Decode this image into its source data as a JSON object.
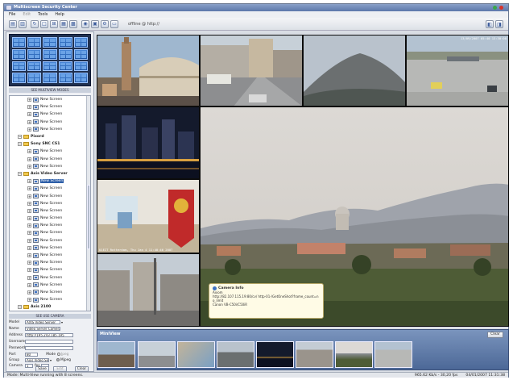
{
  "window": {
    "title": "Multiscreen Security Center",
    "colors": {
      "close": "#d8322a",
      "min": "#3aa84a"
    }
  },
  "menu": [
    "File",
    "Edit",
    "Tools",
    "Help"
  ],
  "menu_disabled": [
    "Edit"
  ],
  "toolbar": {
    "icons": [
      "open-icon",
      "save-icon",
      "refresh-icon",
      "layout-1-icon",
      "layout-4-icon",
      "layout-9-icon",
      "layout-16-icon",
      "snapshot-icon",
      "print-icon",
      "settings-icon",
      "monitor-icon"
    ],
    "address": "offline @ http://",
    "right_icons": [
      "monitor-left-icon",
      "monitor-right-icon"
    ]
  },
  "left": {
    "presets_label": "SEE MULTIVIEW MODES",
    "tree": [
      {
        "level": 1,
        "kind": "screen",
        "label": "New Screen"
      },
      {
        "level": 1,
        "kind": "screen",
        "label": "New Screen"
      },
      {
        "level": 1,
        "kind": "screen",
        "label": "New Screen"
      },
      {
        "level": 1,
        "kind": "screen",
        "label": "New Screen"
      },
      {
        "level": 1,
        "kind": "screen",
        "label": "New Screen"
      },
      {
        "level": 0,
        "kind": "folder",
        "label": "Pixord"
      },
      {
        "level": 0,
        "kind": "folder",
        "label": "Sony SNC CS1"
      },
      {
        "level": 1,
        "kind": "screen",
        "label": "New Screen"
      },
      {
        "level": 1,
        "kind": "screen",
        "label": "New Screen"
      },
      {
        "level": 1,
        "kind": "screen",
        "label": "New Screen"
      },
      {
        "level": 0,
        "kind": "folder",
        "label": "Axis Video Server"
      },
      {
        "level": 1,
        "kind": "screen",
        "label": "New Screen",
        "selected": true
      },
      {
        "level": 1,
        "kind": "screen",
        "label": "New Screen"
      },
      {
        "level": 1,
        "kind": "screen",
        "label": "New Screen"
      },
      {
        "level": 1,
        "kind": "screen",
        "label": "New Screen"
      },
      {
        "level": 1,
        "kind": "screen",
        "label": "New Screen"
      },
      {
        "level": 1,
        "kind": "screen",
        "label": "New Screen"
      },
      {
        "level": 1,
        "kind": "screen",
        "label": "New Screen"
      },
      {
        "level": 1,
        "kind": "screen",
        "label": "New Screen"
      },
      {
        "level": 1,
        "kind": "screen",
        "label": "New Screen"
      },
      {
        "level": 1,
        "kind": "screen",
        "label": "New Screen"
      },
      {
        "level": 1,
        "kind": "screen",
        "label": "New Screen"
      },
      {
        "level": 1,
        "kind": "screen",
        "label": "New Screen"
      },
      {
        "level": 1,
        "kind": "screen",
        "label": "New Screen"
      },
      {
        "level": 1,
        "kind": "screen",
        "label": "New Screen"
      },
      {
        "level": 1,
        "kind": "screen",
        "label": "New Screen"
      },
      {
        "level": 1,
        "kind": "screen",
        "label": "New Screen"
      },
      {
        "level": 1,
        "kind": "screen",
        "label": "New Screen"
      },
      {
        "level": 0,
        "kind": "folder",
        "label": "Axis 2100"
      }
    ],
    "camera_label": "SEE USE CAMERA",
    "form": {
      "model_label": "Model",
      "model_value": "AXIS Video Server",
      "name_label": "Name",
      "name_value": "Video Server Camera 1",
      "address_label": "Address",
      "address_value": "http://195.243.185.195",
      "username_label": "Username",
      "username_value": "",
      "password_label": "Password",
      "password_value": "",
      "port_label": "Port",
      "port_value": "80",
      "mode_label": "Mode",
      "mode_jpeg": "Jpeg",
      "mode_mjpeg": "Mjpeg",
      "group_label": "Group",
      "group_value": "Axis Video Server",
      "camera_label": "Camera",
      "camera_value": "1",
      "fps_label": "fps",
      "save": "Save",
      "edit": "Edit",
      "clear": "Clear"
    }
  },
  "grid": {
    "timestamps": {
      "cam4": "13/09/2007 05:40 13:30:08",
      "cam7": "U1EIT Rotterdam, Thu Jan 4 11:40:46 2007"
    }
  },
  "info": {
    "title": "Camera Info",
    "line1": "Axiom",
    "line2": "http://82.107.115.19:80/cv/ http-01-/GetOneShot?frame_count=no_limit",
    "line3": "Canon VB-C50i/C50iR"
  },
  "miniview": {
    "title": "MiniView",
    "clear": "Clear"
  },
  "status": {
    "left": "Mode: Multi-View running with 8 screens.",
    "rate": "965.62 Kb/s - 30,20 fps",
    "datetime": "04/01/2007 11:31:38"
  }
}
